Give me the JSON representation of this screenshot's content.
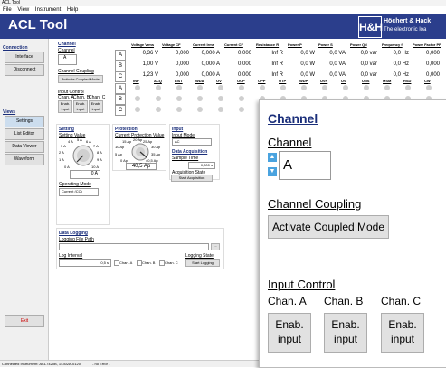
{
  "window": {
    "title": "ACL Tool"
  },
  "menu": [
    "File",
    "View",
    "Instrument",
    "Help"
  ],
  "banner": {
    "app_title": "ACL Tool",
    "logo": "H&H",
    "company": "Höchert & Hack",
    "tagline": "The electronic loa"
  },
  "sidebar": {
    "connection_heading": "Connection",
    "interface": "Interface",
    "disconnect": "Disconnect",
    "views_heading": "Views",
    "settings": "Settings",
    "list_editor": "List Editor",
    "data_viewer": "Data Viewer",
    "waveform": "Waveform",
    "exit": "Exit"
  },
  "channel": {
    "heading": "Channel",
    "channel_label": "Channel",
    "channel_value": "A",
    "coupling_label": "Channel Coupling",
    "coupling_button": "Activate Coupled Mode",
    "input_control_label": "Input Control",
    "chan_a": "Chan. A",
    "chan_b": "Chan. B",
    "chan_c": "Chan. C",
    "enab_input": "Enab. input"
  },
  "measure_table": {
    "headers1": [
      "Voltage Vrms",
      "Voltage CF",
      "Current Irms",
      "Current CF",
      "Resistance R",
      "Power P",
      "Power S",
      "Power Qd",
      "Frequency f",
      "Power Factor PF"
    ],
    "rows": [
      {
        "label": "A",
        "values": [
          "0,36 V",
          "0,000",
          "0,000 A",
          "0,000",
          "Inf R",
          "0,0 W",
          "0,0 VA",
          "0,0 var",
          "0,0 Hz",
          "0,000"
        ]
      },
      {
        "label": "B",
        "values": [
          "1,00 V",
          "0,000",
          "0,000 A",
          "0,000",
          "Inf R",
          "0,0 W",
          "0,0 VA",
          "0,0 var",
          "0,0 Hz",
          "0,000"
        ]
      },
      {
        "label": "C",
        "values": [
          "1,23 V",
          "0,000",
          "0,000 A",
          "0,000",
          "Inf R",
          "0,0 W",
          "0,0 VA",
          "0,0 var",
          "0,0 Hz",
          "0,000"
        ]
      }
    ],
    "headers2": [
      "INP",
      "ACQ",
      "LIST",
      "WDA",
      "OV",
      "OCP",
      "OPP",
      "OTP",
      "WDP",
      "UVP",
      "UV",
      "UNS",
      "MSM",
      "RSD",
      "CW"
    ],
    "status_rows": [
      "A",
      "B",
      "C"
    ]
  },
  "setting": {
    "heading": "Setting",
    "setting_value_label": "Setting Value",
    "knob_ticks": [
      "4 A",
      "5 A",
      "6 A",
      "7 A",
      "8 A",
      "9 A",
      "10 A",
      "3 A",
      "2 A",
      "1 A",
      "0 A"
    ],
    "value": "0 A",
    "operating_mode_label": "Operating Mode",
    "operating_mode_value": "Current (CC)"
  },
  "protection": {
    "heading": "Protection",
    "label": "Current Protection Value",
    "ticks": [
      "15 Ap",
      "20 Ap",
      "25 Ap",
      "10 Ap",
      "30 Ap",
      "5 Ap",
      "35 Ap",
      "0 Ap",
      "40,5 Ap"
    ],
    "value": "40,5 Ap"
  },
  "input": {
    "heading": "Input",
    "mode_label": "Input Mode",
    "mode_value": "AC"
  },
  "acquisition": {
    "heading": "Data Acquisition",
    "sample_time_label": "Sample Time",
    "sample_time_value": "0,000 s",
    "state_label": "Acquisition State",
    "start_button": "Start Acquisition"
  },
  "logging": {
    "heading": "Data Logging",
    "path_label": "Logging File Path",
    "browse": "...",
    "interval_label": "Log Interval",
    "interval_value": "0,5 s",
    "chan_a": "Chan. A",
    "chan_b": "Chan. B",
    "chan_c": "Chan. C",
    "state_label": "Logging State",
    "start_button": "Start Logging"
  },
  "status": {
    "instrument": "Connected Instrument: ACL7420B, 14302A-0120",
    "error": "- no Error -"
  },
  "colors": {
    "banner": "#2b3e8c",
    "heading": "#1a2e7a",
    "led_off": "#cfcfcf"
  }
}
